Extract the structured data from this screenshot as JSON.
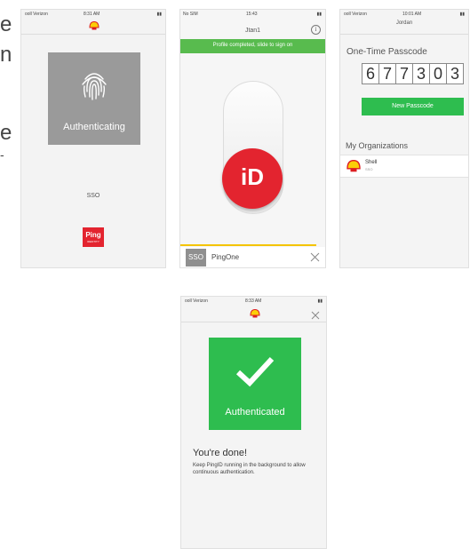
{
  "edge_fragments": [
    "e",
    "n",
    "e",
    "-"
  ],
  "screen1": {
    "status_carrier": "ooll Verizon",
    "status_time": "8:31 AM",
    "auth_label": "Authenticating",
    "sso_label": "SSO",
    "ping_logo": "Ping",
    "ping_sub": "IDENTITY"
  },
  "screen2": {
    "status_carrier": "No SIM",
    "status_time": "15:43",
    "title": "Jtan1",
    "banner": "Profile completed, slide to sign on",
    "id_label": "iD",
    "sso_badge": "SSO",
    "org_name": "PingOne"
  },
  "screen3": {
    "status_carrier": "ooll Verizon",
    "status_time": "10:01 AM",
    "title": "Jordan",
    "otp_heading": "One-Time Passcode",
    "otp_digits": [
      "6",
      "7",
      "7",
      "3",
      "0",
      "3"
    ],
    "new_passcode_label": "New Passcode",
    "orgs_heading": "My Organizations",
    "org_name": "Shell",
    "org_sub": "SSO"
  },
  "screen4": {
    "status_carrier": "ooll Verizon",
    "status_time": "8:33 AM",
    "auth_label": "Authenticated",
    "done_heading": "You're done!",
    "done_body": "Keep PingID running in the background to allow continuous authentication."
  },
  "colors": {
    "green": "#2ebd4f",
    "banner_green": "#58bb4e",
    "red": "#e3242f",
    "gray_tile": "#9a9a9a",
    "shell_yellow": "#fbce07",
    "shell_red": "#dd1d21"
  }
}
